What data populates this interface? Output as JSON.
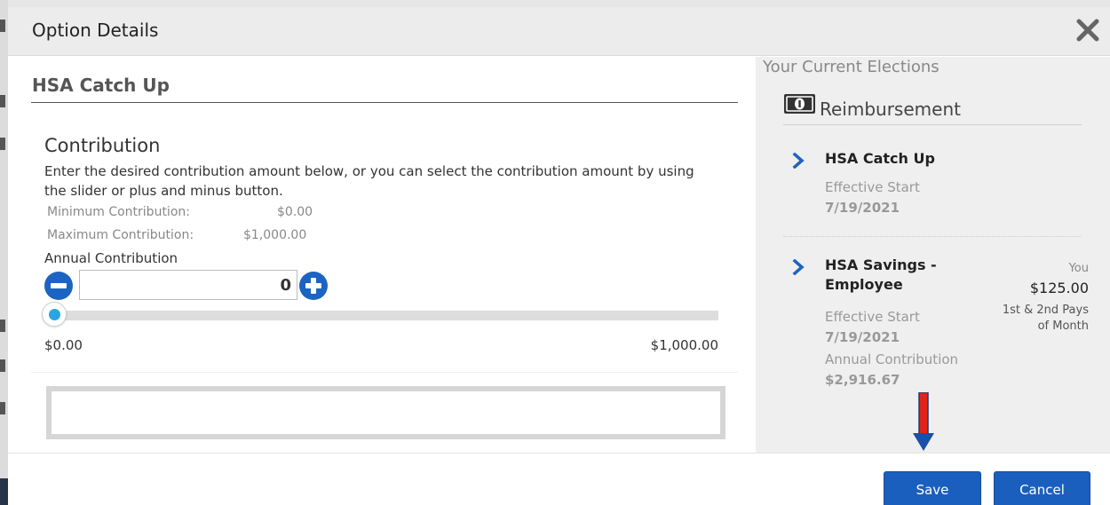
{
  "modal": {
    "title": "Option Details",
    "close_icon": "close-icon"
  },
  "option": {
    "title": "HSA Catch Up"
  },
  "contribution": {
    "heading": "Contribution",
    "description": "Enter the desired contribution amount below, or you can select the contribution amount by using the slider or plus and minus button.",
    "min_label": "Minimum Contribution:",
    "min_value": "$0.00",
    "max_label": "Maximum Contribution:",
    "max_value": "$1,000.00",
    "annual_label": "Annual Contribution",
    "input_value": "0",
    "slider": {
      "min_label": "$0.00",
      "max_label": "$1,000.00",
      "position_fraction": 0
    }
  },
  "elections": {
    "title": "Your Current Elections",
    "category_icon": "money-bill-icon",
    "category": "Reimbursement",
    "items": [
      {
        "name": "HSA Catch Up",
        "effective_label": "Effective Start",
        "effective_date": "7/19/2021"
      },
      {
        "name_line1": "HSA Savings -",
        "name_line2": "Employee",
        "effective_label": "Effective Start",
        "effective_date": "7/19/2021",
        "annual_label": "Annual Contribution",
        "annual_value": "$2,916.67",
        "you_label": "You",
        "you_amount": "$125.00",
        "frequency_line1": "1st & 2nd Pays",
        "frequency_line2": "of Month"
      }
    ]
  },
  "footer": {
    "save_label": "Save",
    "cancel_label": "Cancel"
  },
  "colors": {
    "primary_button": "#1b5fbe",
    "stepper": "#1b64c2",
    "slider_handle": "#29a6e0",
    "annotation_arrow": "#e2231a"
  }
}
